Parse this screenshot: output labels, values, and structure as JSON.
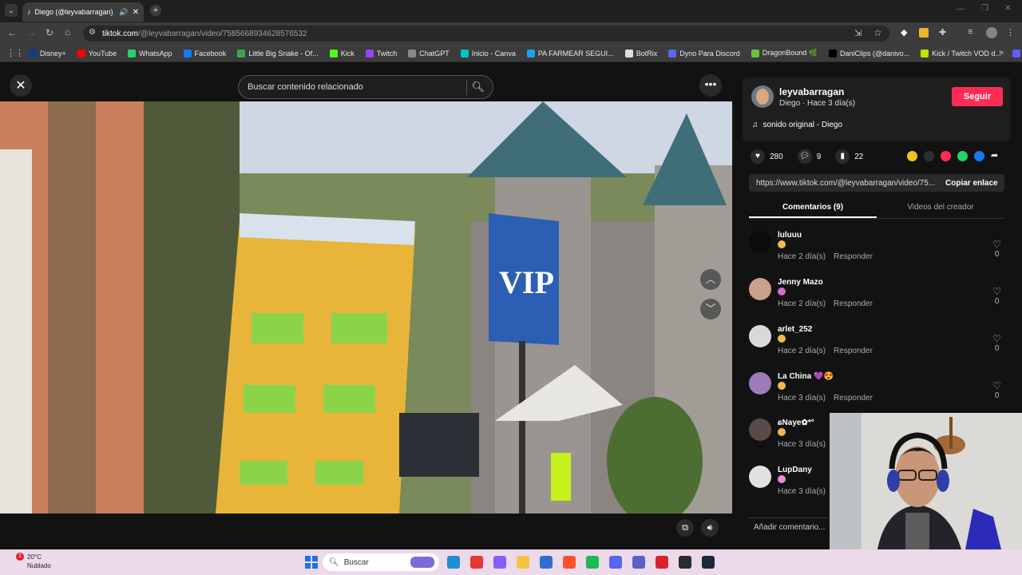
{
  "browser": {
    "tab_title": "Diego (@leyvabarragan) | TikTok",
    "url_domain": "tiktok.com",
    "url_path": "/@leyvabarragan/video/7585668934628576532",
    "bookmarks": [
      {
        "label": "Disney+",
        "color": "#0e3c8c"
      },
      {
        "label": "YouTube",
        "color": "#ff0000"
      },
      {
        "label": "WhatsApp",
        "color": "#25d366"
      },
      {
        "label": "Facebook",
        "color": "#1877f2"
      },
      {
        "label": "Little Big Snake - Of...",
        "color": "#3aa757"
      },
      {
        "label": "Kick",
        "color": "#53fc18"
      },
      {
        "label": "Twitch",
        "color": "#9146ff"
      },
      {
        "label": "ChatGPT",
        "color": "#888888"
      },
      {
        "label": "Inicio - Canva",
        "color": "#00c4cc"
      },
      {
        "label": "PA FARMEAR SEGUI...",
        "color": "#1da1f2"
      },
      {
        "label": "BotRix",
        "color": "#dddddd"
      },
      {
        "label": "Dyno Para Discord",
        "color": "#5865f2"
      },
      {
        "label": "DragonBound 🌿",
        "color": "#6cbf3a"
      },
      {
        "label": "DaniClips (@danivo...",
        "color": "#000000"
      },
      {
        "label": "Kick / Twitch VOD d...",
        "color": "#c4e000"
      },
      {
        "label": "Stripe Express",
        "color": "#635bff"
      }
    ]
  },
  "page": {
    "search_placeholder": "Buscar contenido relacionado",
    "author": {
      "username": "leyvabarragan",
      "subtitle": "Diego · Hace 3 día(s)",
      "follow_label": "Seguir",
      "music": "sonido original - Diego"
    },
    "stats": {
      "likes": "280",
      "comments": "9",
      "saves": "22"
    },
    "link": {
      "url": "https://www.tiktok.com/@leyvabarragan/video/75...",
      "copy_label": "Copiar enlace"
    },
    "tabs": {
      "comments": "Comentarios (9)",
      "videos": "Videos del creador"
    },
    "comments": [
      {
        "name": "luluuu",
        "meta": "Hace 2 día(s)",
        "reply": "Responder",
        "likes": "0",
        "avatar": "#0b0b0b",
        "emoji": "#f1b84c"
      },
      {
        "name": "Jenny Mazo",
        "meta": "Hace 2 día(s)",
        "reply": "Responder",
        "likes": "0",
        "avatar": "#caa08a",
        "emoji": "#d36bd0"
      },
      {
        "name": "arlet_252",
        "meta": "Hace 2 día(s)",
        "reply": "Responder",
        "likes": "0",
        "avatar": "#d9d9d9",
        "emoji": "#f1b84c"
      },
      {
        "name": "La China 💜😍",
        "meta": "Hace 3 día(s)",
        "reply": "Responder",
        "likes": "0",
        "avatar": "#9b7bb8",
        "emoji": "#f1b84c"
      },
      {
        "name": "ɕNaye✿*°",
        "meta": "Hace 3 día(s)",
        "reply": "",
        "likes": "",
        "avatar": "#5a4a48",
        "emoji": "#f1b84c"
      },
      {
        "name": "LupDany",
        "meta": "Hace 3 día(s)",
        "reply": "",
        "likes": "",
        "avatar": "#e2e2e2",
        "emoji": "#e98ad4"
      }
    ],
    "add_comment": "Añadir comentario..."
  },
  "taskbar": {
    "weather_temp": "20°C",
    "weather_desc": "Nublado",
    "search": "Buscar",
    "notification_count": "1"
  },
  "colors": {
    "accent": "#fe2c55",
    "background": "#121212"
  }
}
